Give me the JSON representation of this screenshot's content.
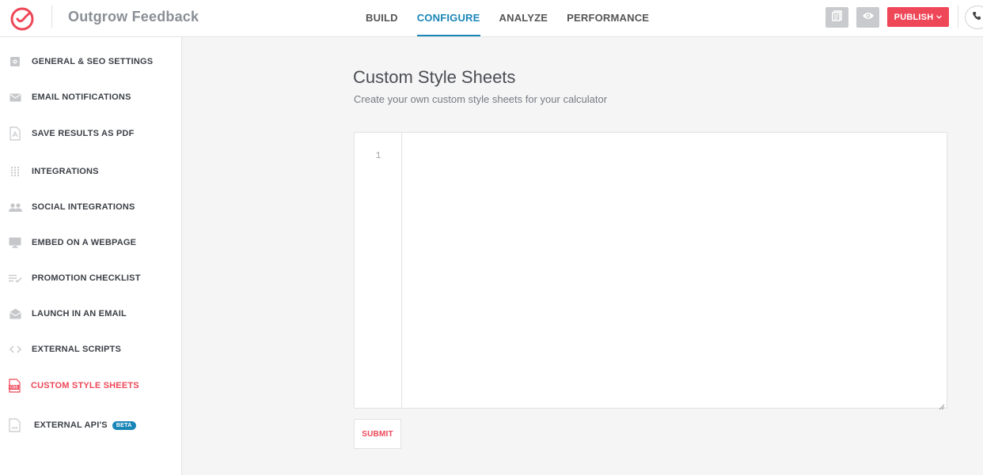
{
  "app": {
    "title": "Outgrow Feedback",
    "logo_icon": "outgrow-logo-icon",
    "brand_color": "#ee4758"
  },
  "nav": {
    "items": [
      {
        "label": "BUILD",
        "active": false
      },
      {
        "label": "CONFIGURE",
        "active": true
      },
      {
        "label": "ANALYZE",
        "active": false
      },
      {
        "label": "PERFORMANCE",
        "active": false
      }
    ],
    "active_color": "#1a86b8"
  },
  "toolbar": {
    "docs_icon": "document-icon",
    "preview_icon": "eye-icon",
    "publish_label": "PUBLISH",
    "publish_chevron": "chevron-down-icon",
    "phone_icon": "phone-icon"
  },
  "sidebar": {
    "items": [
      {
        "label": "GENERAL & SEO SETTINGS",
        "icon": "settings-gear-icon"
      },
      {
        "label": "EMAIL NOTIFICATIONS",
        "icon": "envelope-icon"
      },
      {
        "label": "SAVE RESULTS AS PDF",
        "icon": "pdf-file-icon"
      },
      {
        "label": "INTEGRATIONS",
        "icon": "dot-grid-icon"
      },
      {
        "label": "SOCIAL INTEGRATIONS",
        "icon": "people-icon"
      },
      {
        "label": "EMBED ON A WEBPAGE",
        "icon": "monitor-icon"
      },
      {
        "label": "PROMOTION CHECKLIST",
        "icon": "checklist-icon"
      },
      {
        "label": "LAUNCH IN AN EMAIL",
        "icon": "open-envelope-icon"
      },
      {
        "label": "EXTERNAL SCRIPTS",
        "icon": "code-brackets-icon"
      },
      {
        "label": "CUSTOM STYLE SHEETS",
        "icon": "css-file-icon",
        "active": true
      },
      {
        "label": "EXTERNAL API'S",
        "icon": "api-file-icon",
        "badge": "BETA"
      }
    ]
  },
  "main": {
    "title": "Custom Style Sheets",
    "subtitle": "Create your own custom style sheets for your calculator",
    "editor": {
      "line_number": "1",
      "content": ""
    },
    "submit_label": "SUBMIT"
  }
}
